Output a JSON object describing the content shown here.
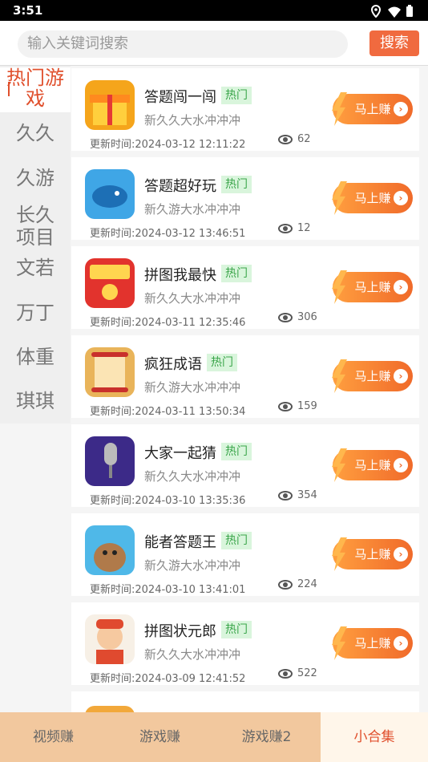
{
  "status": {
    "time": "3:51"
  },
  "search": {
    "placeholder": "输入关键词搜索",
    "button": "搜索"
  },
  "sidebar": {
    "items": [
      {
        "label": "热门游戏",
        "active": true
      },
      {
        "label": "久久"
      },
      {
        "label": "久游"
      },
      {
        "label": "长久项目"
      },
      {
        "label": "文若"
      },
      {
        "label": "万丁"
      },
      {
        "label": "体重"
      },
      {
        "label": "琪琪"
      }
    ]
  },
  "games": [
    {
      "title": "答题闯一闯",
      "badge": "热门",
      "sub": "新久久大水冲冲冲",
      "time": "更新时间:2024-03-12 12:11:22",
      "views": "62",
      "icon": "gift-box-icon",
      "color": "#f5a51b"
    },
    {
      "title": "答题超好玩",
      "badge": "热门",
      "sub": "新久游大水冲冲冲",
      "time": "更新时间:2024-03-12 13:46:51",
      "views": "12",
      "icon": "whale-icon",
      "color": "#3fa6e6"
    },
    {
      "title": "拼图我最快",
      "badge": "热门",
      "sub": "新久久大水冲冲冲",
      "time": "更新时间:2024-03-11 12:35:46",
      "views": "306",
      "icon": "red-envelope-icon",
      "color": "#e2332d"
    },
    {
      "title": "疯狂成语",
      "badge": "热门",
      "sub": "新久游大水冲冲冲",
      "time": "更新时间:2024-03-11 13:50:34",
      "views": "159",
      "icon": "scroll-icon",
      "color": "#e9b45a"
    },
    {
      "title": "大家一起猜",
      "badge": "热门",
      "sub": "新久久大水冲冲冲",
      "time": "更新时间:2024-03-10 13:35:36",
      "views": "354",
      "icon": "microphone-icon",
      "color": "#3c2a88"
    },
    {
      "title": "能者答题王",
      "badge": "热门",
      "sub": "新久游大水冲冲冲",
      "time": "更新时间:2024-03-10 13:41:01",
      "views": "224",
      "icon": "walrus-icon",
      "color": "#4fb8e8"
    },
    {
      "title": "拼图状元郎",
      "badge": "热门",
      "sub": "新久久大水冲冲冲",
      "time": "更新时间:2024-03-09 12:41:52",
      "views": "522",
      "icon": "boy-avatar-icon",
      "color": "#e04a2f"
    }
  ],
  "earn_button": "马上赚",
  "tabs": [
    {
      "label": "视频赚"
    },
    {
      "label": "游戏赚"
    },
    {
      "label": "游戏赚2"
    },
    {
      "label": "小合集",
      "active": true
    }
  ]
}
